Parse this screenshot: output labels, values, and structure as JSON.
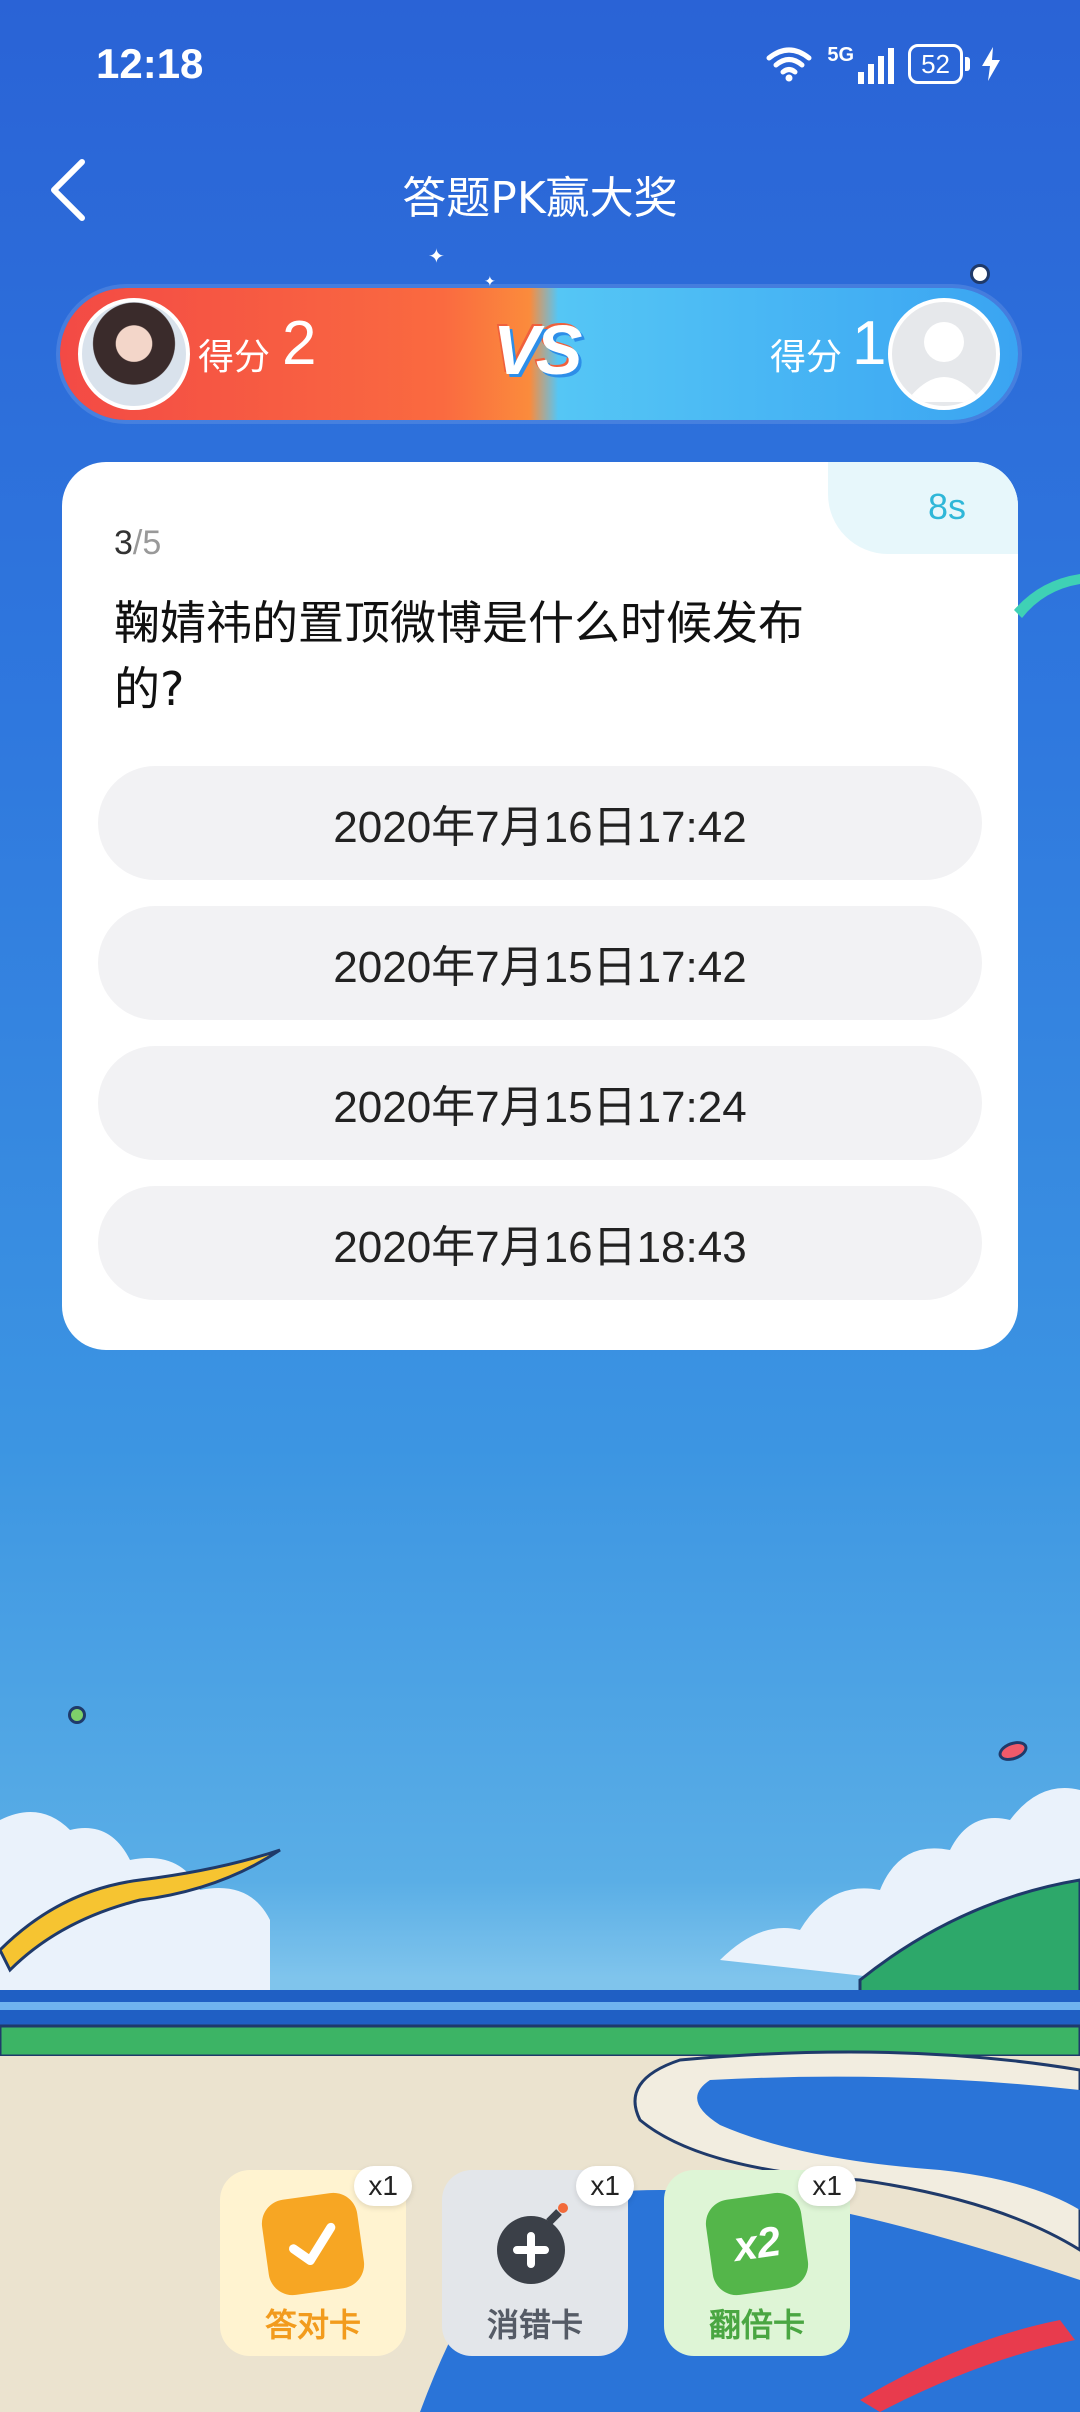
{
  "status_bar": {
    "time": "12:18",
    "network": "5G",
    "battery": "52"
  },
  "header": {
    "title": "答题PK赢大奖"
  },
  "pk": {
    "left_player": {
      "score_label": "得分",
      "score": "2"
    },
    "vs_label": "VS",
    "right_player": {
      "score_label": "得分",
      "score": "1"
    }
  },
  "question": {
    "timer": "8s",
    "current": "3",
    "total": "/5",
    "text": "鞠婧祎的置顶微博是什么时候发布的?",
    "options": [
      "2020年7月16日17:42",
      "2020年7月15日17:42",
      "2020年7月15日17:24",
      "2020年7月16日18:43"
    ]
  },
  "powerups": [
    {
      "label": "答对卡",
      "count": "x1",
      "color": "#f7a623"
    },
    {
      "label": "消错卡",
      "count": "x1",
      "color": "#555b66"
    },
    {
      "label": "翻倍卡",
      "count": "x1",
      "color": "#54b64a"
    }
  ]
}
